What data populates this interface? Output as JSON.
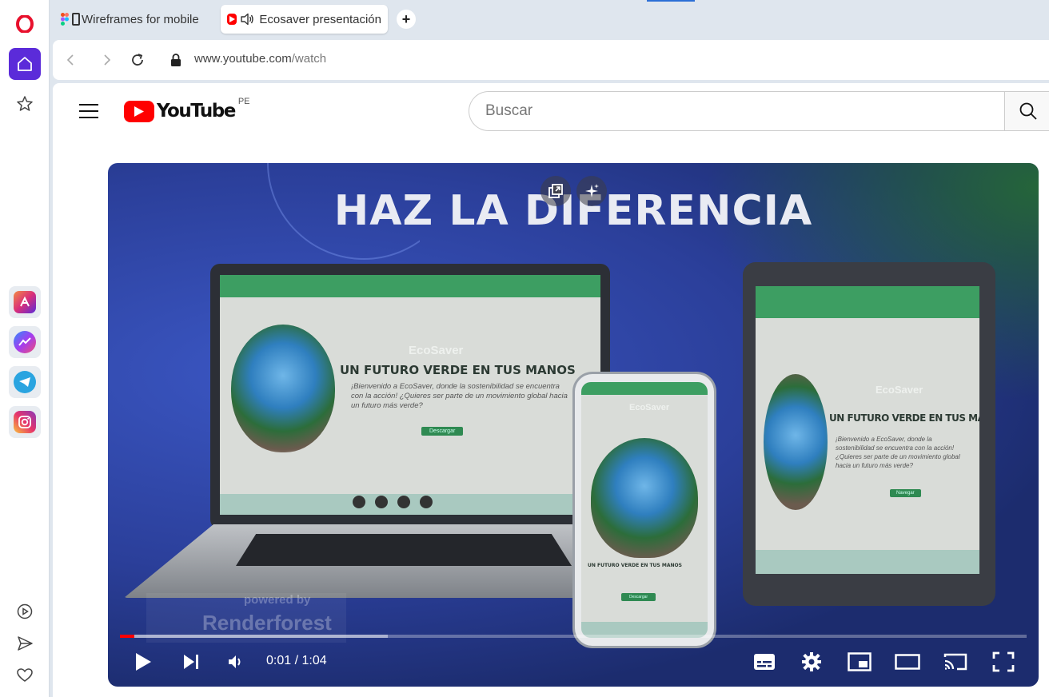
{
  "browser": {
    "tabs": [
      {
        "label": "Wireframes for mobile",
        "icon": "figma-icon"
      },
      {
        "label": "Ecosaver presentación",
        "icon": "youtube-icon",
        "audio": true
      }
    ],
    "new_tab": "+",
    "url_host": "www.youtube.com",
    "url_path": "/watch"
  },
  "youtube": {
    "logo_text": "YouTube",
    "region": "PE",
    "search_placeholder": "Buscar"
  },
  "video": {
    "headline": "HAZ LA DIFERENCIA",
    "laptop": {
      "brand": "EcoSaver",
      "title": "UN FUTURO VERDE EN TUS MANOS",
      "text": "¡Bienvenido a EcoSaver, donde la sostenibilidad se encuentra con la acción! ¿Quieres ser parte de un movimiento global hacia un futuro más verde?",
      "button": "Descargar"
    },
    "tablet": {
      "brand": "EcoSaver",
      "title": "UN FUTURO VERDE EN TUS MANOS",
      "text": "¡Bienvenido a EcoSaver, donde la sostenibilidad se encuentra con la acción! ¿Quieres ser parte de un movimiento global hacia un futuro más verde?",
      "button": "Navegar"
    },
    "phone": {
      "brand": "EcoSaver",
      "title": "UN FUTURO VERDE EN TUS MANOS",
      "button": "Descargar"
    },
    "watermark_line1": "powered by",
    "watermark_line2": "Renderforest",
    "progress": 0.016,
    "buffered": 0.295,
    "time_current": "0:01",
    "time_total": "1:04",
    "time_display": "0:01 / 1:04"
  },
  "colors": {
    "accent_red": "#ff0000",
    "opera_red": "#e8112d",
    "sidebar_active": "#5b2bd9",
    "site_green": "#3daa6a"
  }
}
